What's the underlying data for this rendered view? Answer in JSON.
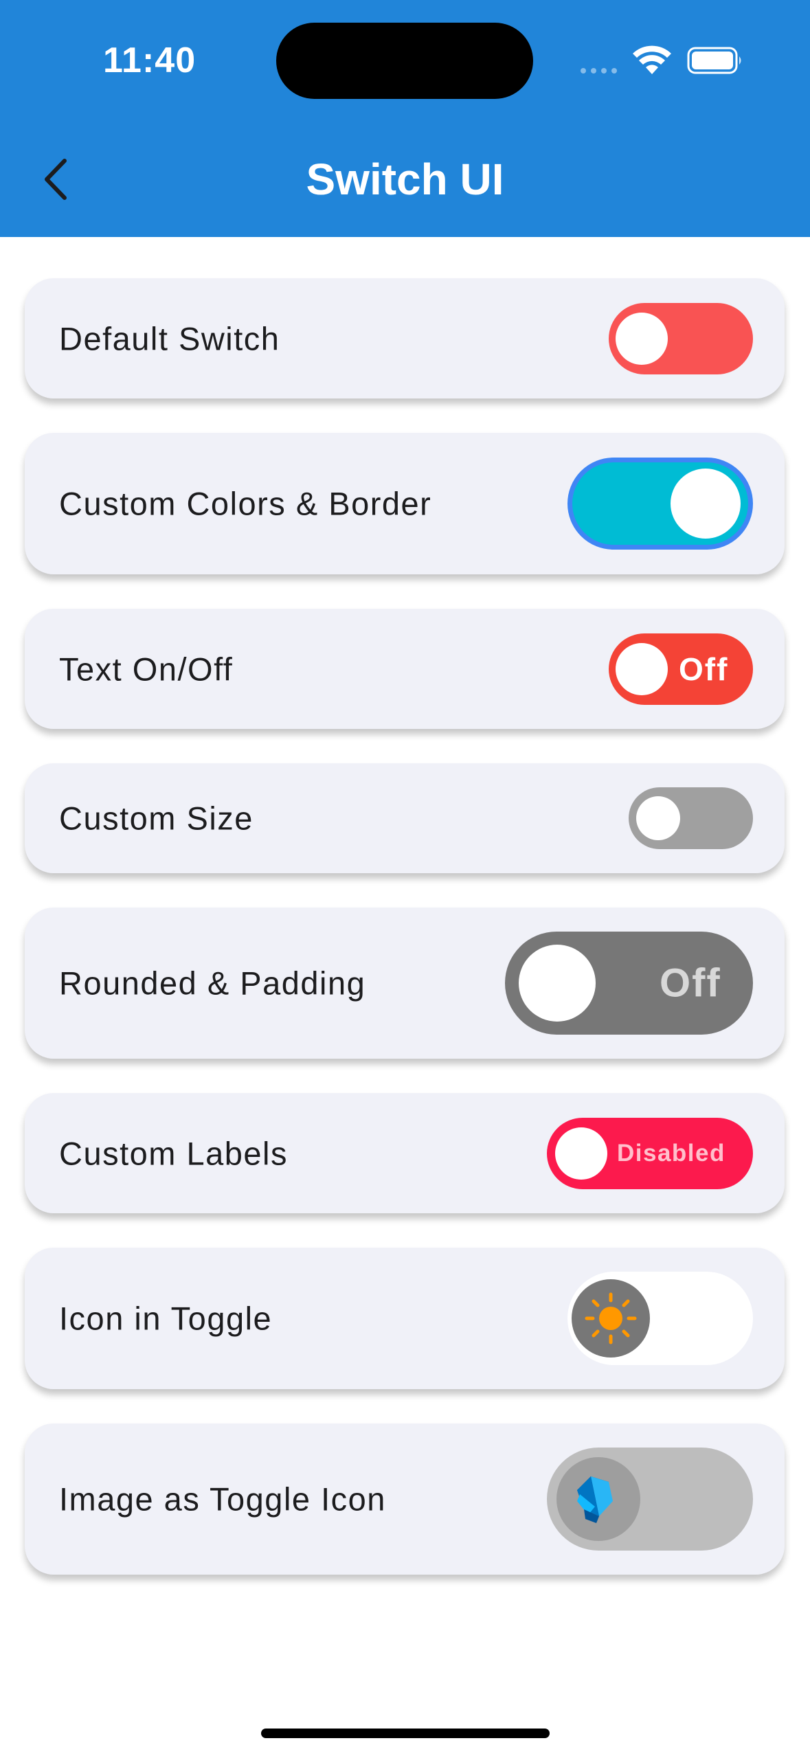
{
  "status_bar": {
    "time": "11:40"
  },
  "header": {
    "title": "Switch UI",
    "back_icon": "chevron-left-icon"
  },
  "colors": {
    "header": "#2185d9",
    "card": "#f0f1f8",
    "default_track": "#f95353",
    "custom_track": "#00bcd4",
    "custom_border": "#3f86f5",
    "text_track": "#f44336",
    "size_track": "#a0a0a0",
    "rounded_track": "#777777",
    "labels_track": "#fc1a4d",
    "icon_knob": "#777777",
    "sun": "#ff9800",
    "image_track": "#bdbdbd",
    "image_knob": "#9e9e9e"
  },
  "switches": [
    {
      "label": "Default Switch",
      "state": "off"
    },
    {
      "label": "Custom Colors & Border",
      "state": "on"
    },
    {
      "label": "Text On/Off",
      "state": "off",
      "text": "Off"
    },
    {
      "label": "Custom Size",
      "state": "off"
    },
    {
      "label": "Rounded & Padding",
      "state": "off",
      "text": "Off"
    },
    {
      "label": "Custom Labels",
      "state": "off",
      "text": "Disabled"
    },
    {
      "label": "Icon in Toggle",
      "state": "off",
      "icon": "sun-icon"
    },
    {
      "label": "Image as Toggle Icon",
      "state": "off",
      "icon": "dart-logo-icon"
    }
  ]
}
